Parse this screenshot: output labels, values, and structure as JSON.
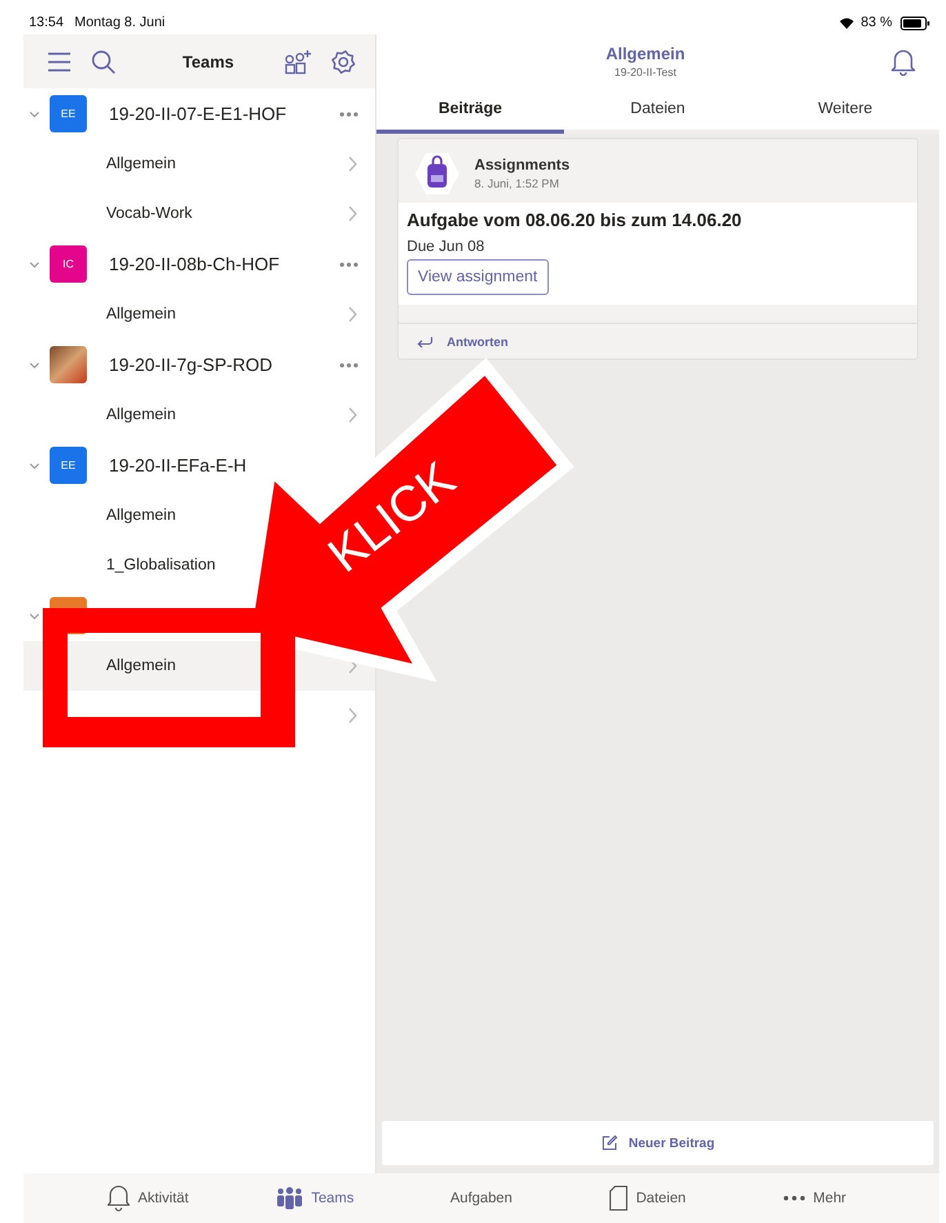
{
  "status_bar": {
    "time": "13:54",
    "date": "Montag 8. Juni",
    "battery": "83 %"
  },
  "sidebar": {
    "title": "Teams",
    "teams": [
      {
        "name": "19-20-II-07-E-E1-HOF",
        "avatar": {
          "kind": "initials",
          "initials": "EE",
          "color": "#1a73e8"
        },
        "expanded": true,
        "more": true,
        "channels": [
          {
            "name": "Allgemein",
            "selected": false
          },
          {
            "name": "Vocab-Work",
            "selected": false
          }
        ]
      },
      {
        "name": "19-20-II-08b-Ch-HOF",
        "avatar": {
          "kind": "initials",
          "initials": "IC",
          "color": "#e3068c"
        },
        "expanded": true,
        "more": true,
        "channels": [
          {
            "name": "Allgemein",
            "selected": false
          }
        ]
      },
      {
        "name": "19-20-II-7g-SP-ROD",
        "avatar": {
          "kind": "photo"
        },
        "expanded": true,
        "more": true,
        "channels": [
          {
            "name": "Allgemein",
            "selected": false
          }
        ]
      },
      {
        "name": "19-20-II-EFa-E-H",
        "avatar": {
          "kind": "initials",
          "initials": "EE",
          "color": "#1a73e8"
        },
        "expanded": true,
        "more": false,
        "channels": [
          {
            "name": "Allgemein",
            "selected": false
          },
          {
            "name": "1_Globalisation",
            "selected": false
          }
        ]
      },
      {
        "avatar": {
          "kind": "initials",
          "color": "#e8782a"
        },
        "expanded": true,
        "more": false,
        "channels": [
          {
            "name": "Allgemein",
            "selected": true
          },
          {
            "selected": false
          }
        ]
      }
    ]
  },
  "channel_header": {
    "title": "Allgemein",
    "subtitle": "19-20-II-Test"
  },
  "tabs": [
    {
      "label": "Beiträge",
      "selected": true
    },
    {
      "label": "Dateien",
      "selected": false
    },
    {
      "label": "Weitere",
      "selected": false
    }
  ],
  "post": {
    "author": "Assignments",
    "time": "8. Juni, 1:52 PM",
    "title": "Aufgabe vom 08.06.20 bis zum 14.06.20",
    "due": "Due Jun 08",
    "button": "View assignment",
    "reply": "Antworten"
  },
  "compose": {
    "label": "Neuer Beitrag"
  },
  "tab_bar": [
    {
      "kind": "bell",
      "label": "Aktivität",
      "selected": false
    },
    {
      "kind": "people",
      "label": "Teams",
      "selected": true
    },
    {
      "kind": "none",
      "label": "Aufgaben",
      "selected": false
    },
    {
      "kind": "file",
      "label": "Dateien",
      "selected": false
    },
    {
      "kind": "dots",
      "label": "Mehr",
      "selected": false
    }
  ],
  "annotation": {
    "label": "KLICK"
  }
}
